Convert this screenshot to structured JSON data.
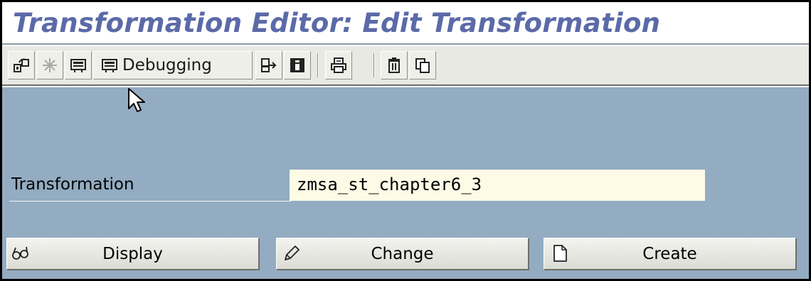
{
  "window": {
    "title": "Transformation Editor: Edit Transformation"
  },
  "toolbar": {
    "items": [
      {
        "icon": "other-object-icon",
        "label": ""
      },
      {
        "icon": "activate-icon",
        "label": ""
      },
      {
        "icon": "test-icon",
        "label": ""
      },
      {
        "icon": "debugging-icon",
        "label": "Debugging"
      },
      {
        "icon": "where-used-icon",
        "label": ""
      },
      {
        "icon": "info-icon",
        "label": ""
      },
      {
        "icon": "print-icon",
        "label": ""
      },
      {
        "icon": "delete-icon",
        "label": ""
      },
      {
        "icon": "copy-icon",
        "label": ""
      }
    ]
  },
  "form": {
    "transformation_label": "Transformation",
    "transformation_value": "zmsa_st_chapter6_3"
  },
  "actions": {
    "display_label": "Display",
    "change_label": "Change",
    "create_label": "Create"
  },
  "colors": {
    "title": "#5b6aa8",
    "content_bg": "#93acc1",
    "input_bg": "#fdfbe6",
    "toolbar_bg": "#e9e9e4"
  }
}
